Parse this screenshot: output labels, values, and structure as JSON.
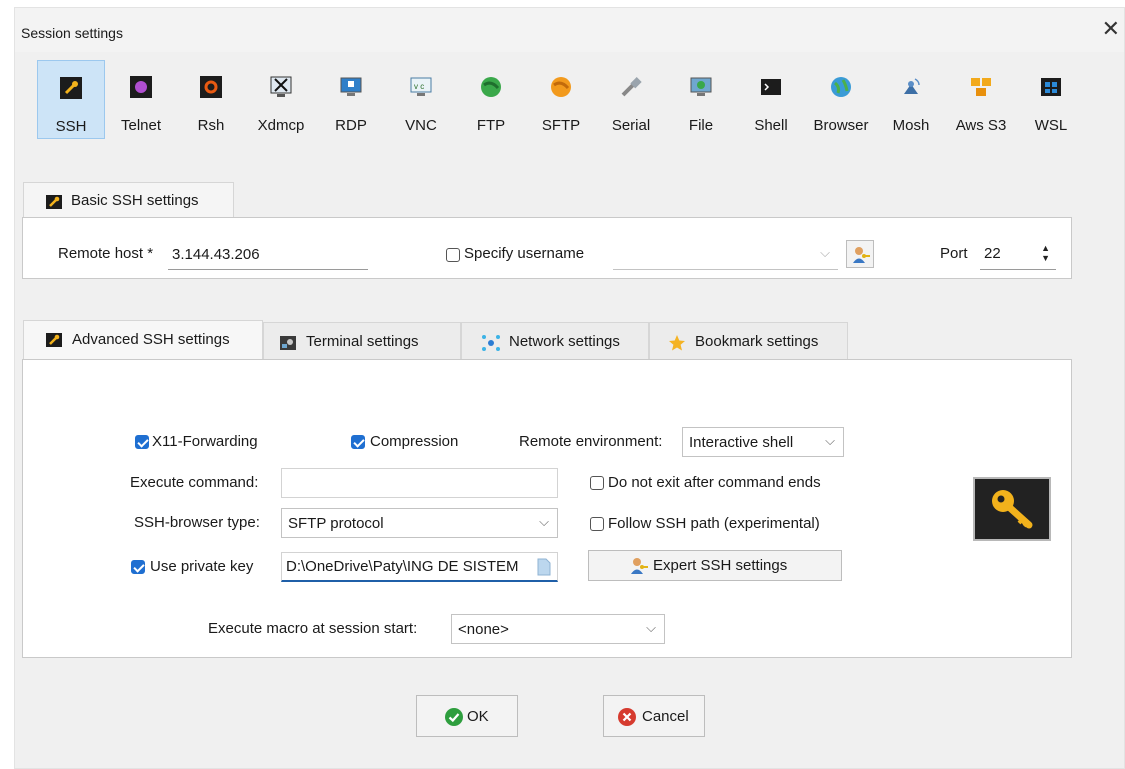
{
  "window": {
    "title": "Session settings",
    "close_glyph": "✕"
  },
  "protocols": [
    {
      "label": "SSH",
      "icon": "ssh-icon",
      "selected": true
    },
    {
      "label": "Telnet",
      "icon": "telnet-icon"
    },
    {
      "label": "Rsh",
      "icon": "rsh-icon"
    },
    {
      "label": "Xdmcp",
      "icon": "xdmcp-icon"
    },
    {
      "label": "RDP",
      "icon": "rdp-icon"
    },
    {
      "label": "VNC",
      "icon": "vnc-icon"
    },
    {
      "label": "FTP",
      "icon": "ftp-icon"
    },
    {
      "label": "SFTP",
      "icon": "sftp-icon"
    },
    {
      "label": "Serial",
      "icon": "serial-icon"
    },
    {
      "label": "File",
      "icon": "file-icon"
    },
    {
      "label": "Shell",
      "icon": "shell-icon"
    },
    {
      "label": "Browser",
      "icon": "browser-icon"
    },
    {
      "label": "Mosh",
      "icon": "mosh-icon"
    },
    {
      "label": "Aws S3",
      "icon": "aws-s3-icon"
    },
    {
      "label": "WSL",
      "icon": "wsl-icon"
    }
  ],
  "basic": {
    "tab_label": "Basic SSH settings",
    "remote_host_label": "Remote host *",
    "remote_host_value": "3.144.43.206",
    "specify_username_label": "Specify username",
    "specify_username_checked": false,
    "username_value": "",
    "port_label": "Port",
    "port_value": "22"
  },
  "tabs": [
    {
      "label": "Advanced SSH settings",
      "icon": "wrench-icon",
      "active": true
    },
    {
      "label": "Terminal settings",
      "icon": "terminal-icon"
    },
    {
      "label": "Network settings",
      "icon": "network-icon"
    },
    {
      "label": "Bookmark settings",
      "icon": "star-icon"
    }
  ],
  "advanced": {
    "x11_label": "X11-Forwarding",
    "x11_checked": true,
    "compression_label": "Compression",
    "compression_checked": true,
    "remote_env_label": "Remote environment:",
    "remote_env_value": "Interactive shell",
    "execute_command_label": "Execute command:",
    "execute_command_value": "",
    "do_not_exit_label": "Do not exit after command ends",
    "do_not_exit_checked": false,
    "browser_type_label": "SSH-browser type:",
    "browser_type_value": "SFTP protocol",
    "follow_path_label": "Follow SSH path (experimental)",
    "follow_path_checked": false,
    "private_key_label": "Use private key",
    "private_key_checked": true,
    "private_key_value": "D:\\OneDrive\\Paty\\ING DE SISTEM",
    "expert_button_label": "Expert SSH settings",
    "macro_label": "Execute macro at session start:",
    "macro_value": "<none>"
  },
  "footer": {
    "ok_label": "OK",
    "cancel_label": "Cancel"
  },
  "colors": {
    "accent": "#1f6fd1",
    "selected_bg": "#cde4f7",
    "ok_green": "#2e9e3e",
    "cancel_red": "#d63b2f"
  }
}
